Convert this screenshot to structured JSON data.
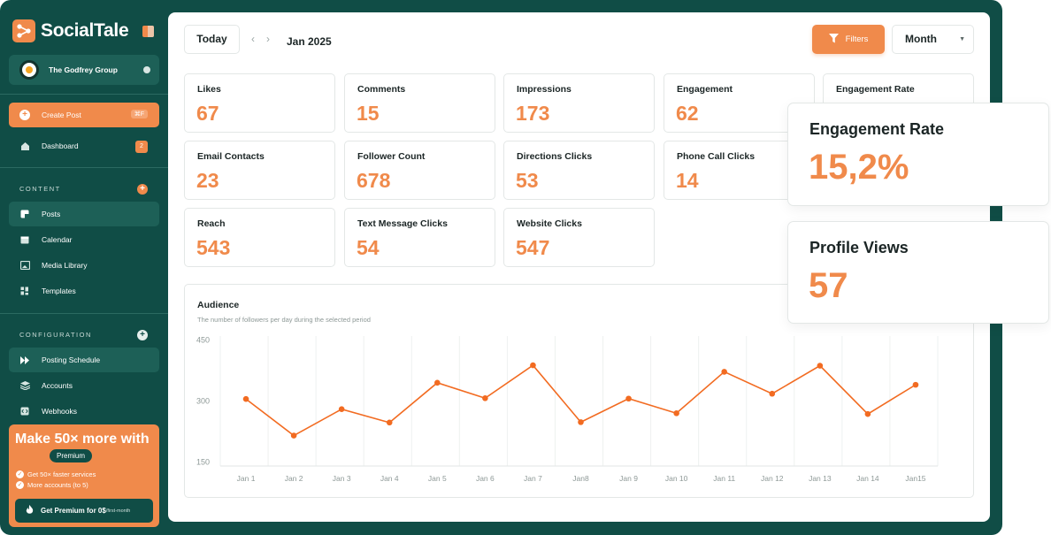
{
  "app": {
    "name": "SocialTale"
  },
  "org": {
    "name": "The Godfrey Group"
  },
  "sidebar": {
    "create_post": {
      "label": "Create Post",
      "shortcut": "⌘F"
    },
    "dashboard": {
      "label": "Dashboard",
      "badge": "2"
    },
    "content_section": "CONTENT",
    "content_items": [
      {
        "label": "Posts",
        "icon": "posts-icon"
      },
      {
        "label": "Calendar",
        "icon": "calendar-icon"
      },
      {
        "label": "Media Library",
        "icon": "media-icon"
      },
      {
        "label": "Templates",
        "icon": "templates-icon"
      }
    ],
    "config_section": "CONFIGURATION",
    "config_items": [
      {
        "label": "Posting Schedule",
        "icon": "schedule-icon"
      },
      {
        "label": "Accounts",
        "icon": "accounts-icon"
      },
      {
        "label": "Webhooks",
        "icon": "webhooks-icon"
      }
    ],
    "promo": {
      "title": "Make 50× more with",
      "pill": "Premium",
      "features": [
        "Get 50× faster services",
        "More accounts (to 5)"
      ],
      "button": "Get Premium for 0$",
      "button_suffix": "/first-month"
    }
  },
  "toolbar": {
    "today": "Today",
    "period": "Jan 2025",
    "filters": "Filters",
    "range": "Month"
  },
  "metrics": [
    {
      "label": "Likes",
      "value": "67"
    },
    {
      "label": "Comments",
      "value": "15"
    },
    {
      "label": "Impressions",
      "value": "173"
    },
    {
      "label": "Engagement",
      "value": "62"
    },
    {
      "label": "Engagement Rate",
      "value": ""
    },
    {
      "label": "Email Contacts",
      "value": "23"
    },
    {
      "label": "Follower Count",
      "value": "678"
    },
    {
      "label": "Directions Clicks",
      "value": "53"
    },
    {
      "label": "Phone Call Clicks",
      "value": "14"
    },
    {
      "label": "Reach",
      "value": "543"
    },
    {
      "label": "Text Message Clicks",
      "value": "54"
    },
    {
      "label": "Website Clicks",
      "value": "547"
    }
  ],
  "audience": {
    "title": "Audience",
    "subtitle": "The number of followers per day during the selected period"
  },
  "chart_data": {
    "type": "line",
    "x": [
      "Jan 1",
      "Jan 2",
      "Jan 3",
      "Jan 4",
      "Jan 5",
      "Jan 6",
      "Jan 7",
      "Jan8",
      "Jan 9",
      "Jan 10",
      "Jan 11",
      "Jan 12",
      "Jan 13",
      "Jan 14",
      "Jan15"
    ],
    "series": [
      {
        "values": [
          305,
          215,
          280,
          247,
          345,
          307,
          388,
          248,
          306,
          270,
          372,
          318,
          387,
          268,
          340
        ]
      }
    ],
    "yticks": [
      "450",
      "300",
      "150"
    ],
    "ylim": [
      140,
      460
    ],
    "color": "#f26b21",
    "grid": "vertical"
  },
  "highlights": [
    {
      "label": "Engagement Rate",
      "value": "15,2%"
    },
    {
      "label": "Profile Views",
      "value": "57"
    }
  ],
  "colors": {
    "brand": "#f08a4b",
    "sidebar": "#104d46",
    "line": "#f26b21"
  }
}
